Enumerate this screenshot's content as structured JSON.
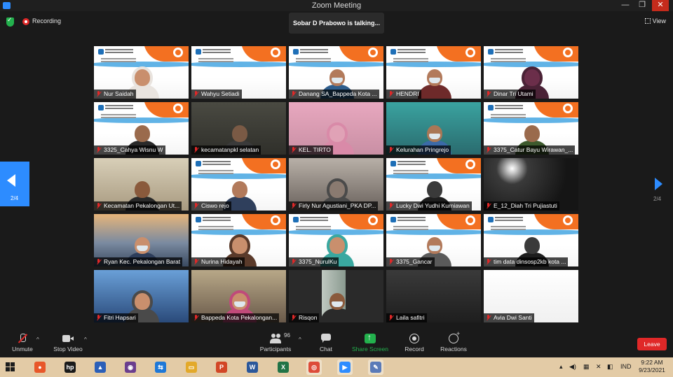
{
  "window": {
    "title": "Zoom Meeting",
    "minimize": "—",
    "maximize": "❐",
    "close": "✕"
  },
  "topbar": {
    "recording_label": "Recording",
    "talking_label": "Sobar D Prabowo is talking...",
    "view_label": "View"
  },
  "pager": {
    "left_label": "2/4",
    "right_label": "2/4"
  },
  "participants": [
    {
      "name": "Nur Saidah",
      "scene": "slide",
      "person": {
        "skin": "#c98f6d",
        "top": "#e9e4df",
        "hijab": true
      }
    },
    {
      "name": "Wahyu Setiadi",
      "scene": "slide",
      "person": null
    },
    {
      "name": "Danang SA_Bappeda Kota ...",
      "scene": "slide",
      "person": {
        "skin": "#b27a5b",
        "top": "#2e5d8c",
        "mask": true
      }
    },
    {
      "name": "HENDRI",
      "scene": "slide",
      "person": {
        "skin": "#b27a5b",
        "top": "#6e2a2a",
        "mask": true
      }
    },
    {
      "name": "Dinar Tri Utami",
      "scene": "slide",
      "person": {
        "skin": "#6b2e4a",
        "top": "#4a2236",
        "hijab": true
      }
    },
    {
      "name": "3325_Cahya Wisnu W",
      "scene": "slide",
      "person": {
        "skin": "#9a6a4c",
        "top": "#2a2a2a"
      }
    },
    {
      "name": "kecamatanpkl selatan",
      "scene": "room-dark",
      "person": {
        "skin": "#7a5a45",
        "top": "#3a3a3a"
      }
    },
    {
      "name": "KEL. TIRTO",
      "scene": "room-pink",
      "person": {
        "skin": "#e0a2b6",
        "top": "#d98aa8",
        "hijab": true
      }
    },
    {
      "name": "Kelurahan Pringrejo",
      "scene": "room-teal",
      "person": {
        "skin": "#a97756",
        "top": "#3b6aa8",
        "mask": true
      }
    },
    {
      "name": "3375_Catur Bayu Wirawan_...",
      "scene": "slide",
      "person": {
        "skin": "#9a6a4c",
        "top": "#3d5a2d"
      }
    },
    {
      "name": "Kecamatan Pekalongan Ut...",
      "scene": "room-beige",
      "person": {
        "skin": "#8a5a3c",
        "top": "#2a2a2a"
      }
    },
    {
      "name": "Ciswo rejo",
      "scene": "slide",
      "person": {
        "skin": "#b27a5b",
        "top": "#2f3f5c"
      }
    },
    {
      "name": "Firly Nur Agustiani_PKA DP...",
      "scene": "room-grey",
      "person": {
        "skin": "#8a7a70",
        "top": "#4a4a4a",
        "hijab": true
      }
    },
    {
      "name": "Lucky Dwi Yudhi Kurniawan",
      "scene": "slide",
      "person": {
        "skin": "#3a3a3a",
        "top": "#1e1e1e"
      }
    },
    {
      "name": "E_12_Diah Tri Pujiastuti",
      "scene": "room-black",
      "person": null
    },
    {
      "name": "Ryan Kec. Pekalongan Barat",
      "scene": "bridge",
      "person": {
        "skin": "#c98f6d",
        "top": "#2d3d5a",
        "mask": true
      }
    },
    {
      "name": "Nurina Hidayah",
      "scene": "slide",
      "person": {
        "skin": "#c98f6d",
        "top": "#5a3a2a",
        "hijab": true
      }
    },
    {
      "name": "3375_NurulKu",
      "scene": "slide",
      "person": {
        "skin": "#c98f6d",
        "top": "#3aa8a0",
        "hijab": true
      }
    },
    {
      "name": "3375_Gancar",
      "scene": "slide",
      "person": {
        "skin": "#b27a5b",
        "top": "#5a5a5a",
        "mask": true
      }
    },
    {
      "name": "tim data dinsosp2kb kota ...",
      "scene": "slide",
      "person": {
        "skin": "#3a3a3a",
        "top": "#1e1e1e"
      }
    },
    {
      "name": "Fitri Hapsari",
      "scene": "skyline",
      "person": {
        "skin": "#c98f6d",
        "top": "#4a4a4a",
        "hijab": true
      }
    },
    {
      "name": "Bappeda Kota Pekalongan...",
      "scene": "office",
      "person": {
        "skin": "#c98f6d",
        "top": "#c04a7a",
        "hijab": true,
        "mask": true
      }
    },
    {
      "name": "Risqon",
      "scene": "room-window",
      "person": {
        "skin": "#8a5a3c",
        "top": "#2a2a2a",
        "mask": true
      }
    },
    {
      "name": "Laila safitri",
      "scene": "room-shelf",
      "person": null
    },
    {
      "name": "Avia Dwi Santi",
      "scene": "doc",
      "person": null
    }
  ],
  "toolbar": {
    "unmute": "Unmute",
    "stop_video": "Stop Video",
    "participants": "Participants",
    "participant_count": "96",
    "chat": "Chat",
    "share_screen": "Share Screen",
    "record": "Record",
    "reactions": "Reactions",
    "leave": "Leave"
  },
  "taskbar": {
    "apps": [
      {
        "name": "firefox",
        "glyph": "●",
        "color": "#e8572a"
      },
      {
        "name": "hp",
        "glyph": "hp",
        "color": "#1a1a1a"
      },
      {
        "name": "scanner",
        "glyph": "▲",
        "color": "#2b5fb8"
      },
      {
        "name": "media",
        "glyph": "◉",
        "color": "#6b3e8e"
      },
      {
        "name": "teamviewer",
        "glyph": "⇆",
        "color": "#1e78d7"
      },
      {
        "name": "explorer",
        "glyph": "▭",
        "color": "#e3a92a"
      },
      {
        "name": "powerpoint",
        "glyph": "P",
        "color": "#d24726"
      },
      {
        "name": "word",
        "glyph": "W",
        "color": "#2b579a"
      },
      {
        "name": "excel",
        "glyph": "X",
        "color": "#217346"
      },
      {
        "name": "chrome",
        "glyph": "◎",
        "color": "#dd4b39"
      },
      {
        "name": "zoom",
        "glyph": "▶",
        "color": "#2d8cff"
      },
      {
        "name": "tool",
        "glyph": "✎",
        "color": "#5a7ab8"
      }
    ],
    "lang": "IND",
    "time": "9:22 AM",
    "date": "9/23/2021"
  }
}
